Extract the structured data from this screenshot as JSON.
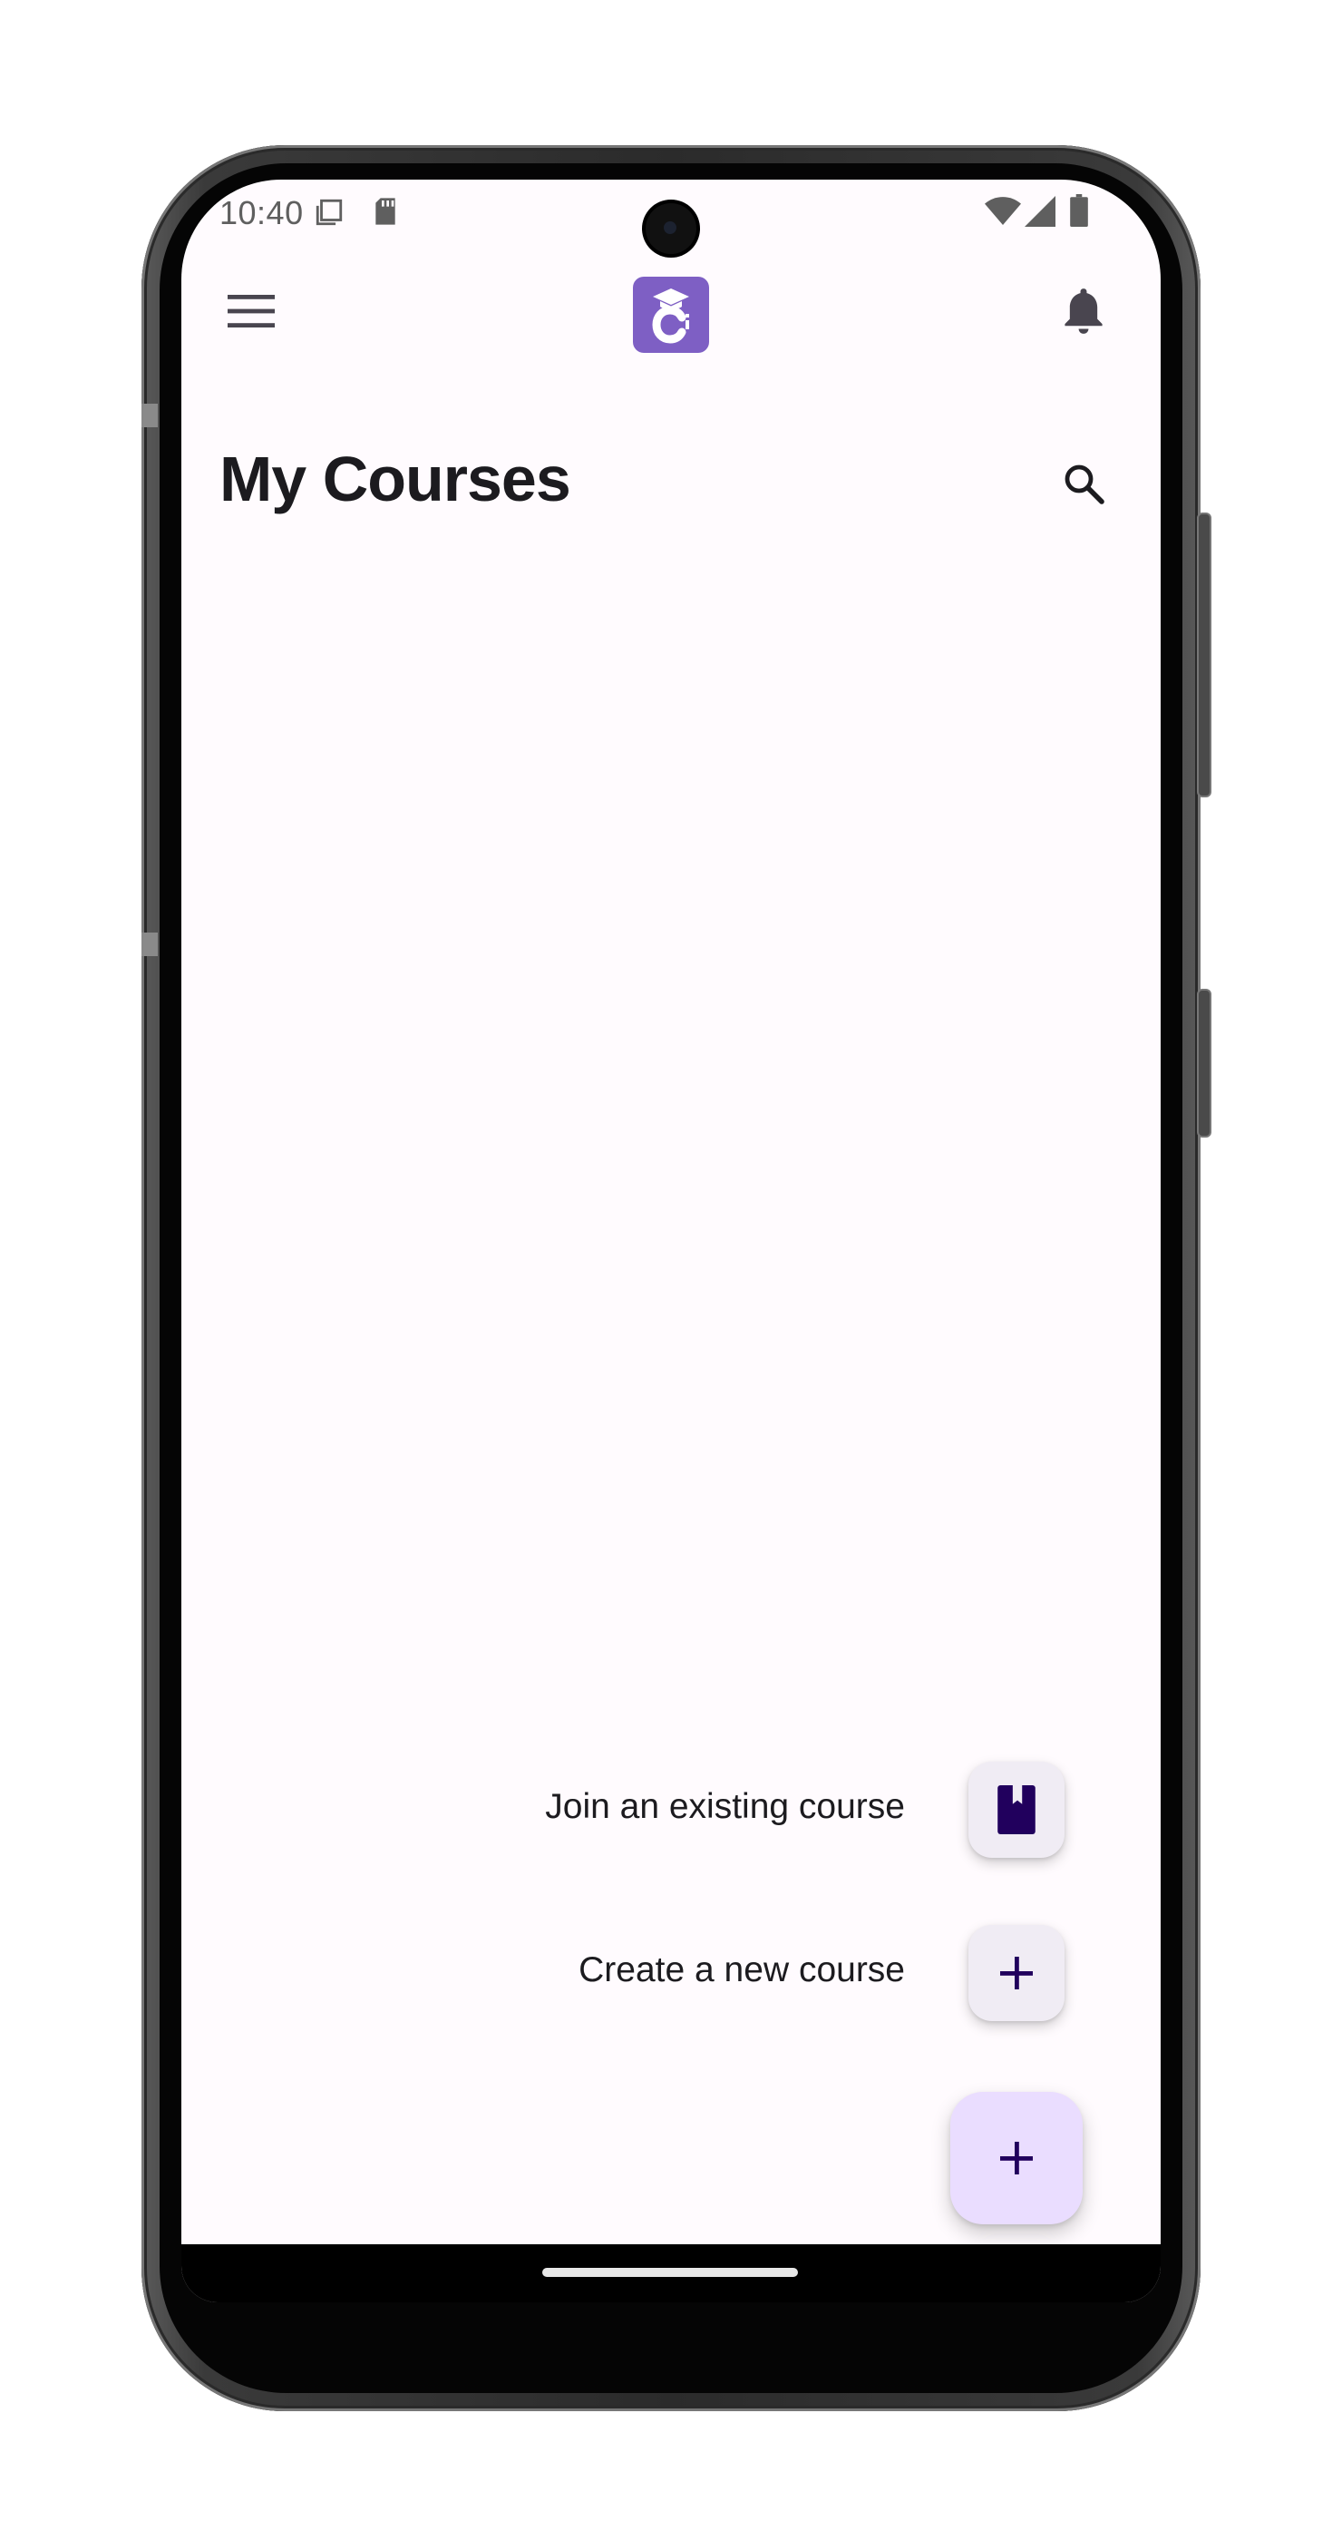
{
  "status_bar": {
    "time": "10:40",
    "icons": [
      "copy-icon",
      "sd-card-icon",
      "wifi-icon",
      "signal-icon",
      "battery-icon"
    ]
  },
  "app_bar": {
    "menu_icon": "menu-icon",
    "logo_icon": "graduation-cap-logo",
    "notifications_icon": "bell-icon"
  },
  "page": {
    "title": "My Courses",
    "search_icon": "search-icon"
  },
  "fab_menu": {
    "options": [
      {
        "label": "Join an existing course",
        "icon": "bookmark-book-icon"
      },
      {
        "label": "Create a new course",
        "icon": "plus-icon"
      }
    ],
    "main_fab_icon": "plus-icon"
  },
  "colors": {
    "background": "#fffbfe",
    "logo": "#7e5fc4",
    "mini_fab": "#f0ecf4",
    "main_fab": "#eaddff",
    "icon_dark": "#21005d",
    "text": "#1c1b1f"
  }
}
